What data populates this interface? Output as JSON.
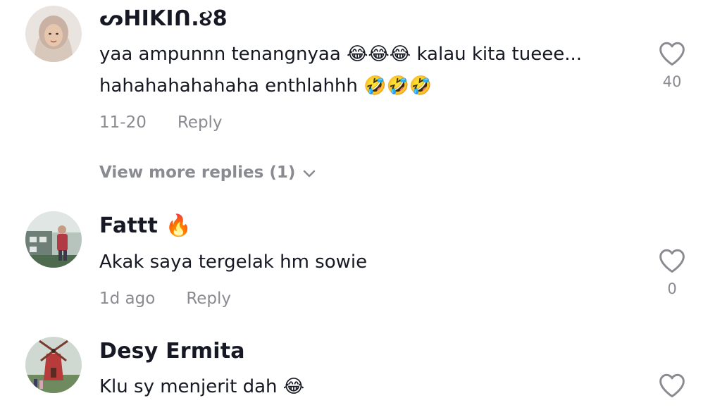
{
  "comments": [
    {
      "username": "ᔕHIKIᑎ.૪8",
      "text": "yaa ampunnn tenangnyaa 😂😂😂 kalau kita tueee...\nhahahahahahaha enthlahhh 🤣🤣🤣",
      "date": "11-20",
      "reply_label": "Reply",
      "like_count": "40",
      "avatar_icon": "hijab-woman-avatar"
    },
    {
      "username": "Fattt 🔥",
      "text": "Akak saya tergelak hm sowie",
      "date": "1d ago",
      "reply_label": "Reply",
      "like_count": "0",
      "avatar_icon": "outdoor-photo-avatar"
    },
    {
      "username": "Desy Ermita",
      "text": "Klu sy menjerit dah 😂",
      "avatar_icon": "windmill-photo-avatar"
    }
  ],
  "view_more": {
    "label": "View more replies (1)"
  },
  "colors": {
    "text": "#161823",
    "muted": "#8a8b91",
    "heart": "#8a8b91"
  }
}
